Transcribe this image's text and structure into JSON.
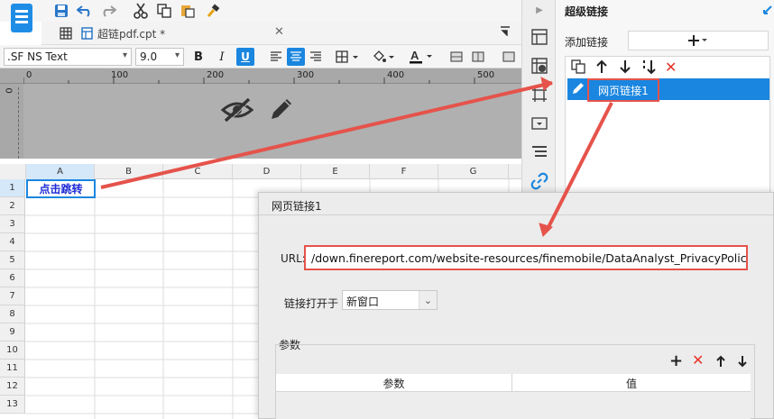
{
  "app": {
    "tab_title": "超链pdf.cpt *",
    "font_name": ".SF NS Text",
    "font_size": "9.0"
  },
  "format": {
    "bold": "B",
    "italic": "I",
    "underline": "U"
  },
  "ruler": {
    "ticks": [
      "0",
      "100",
      "200",
      "300",
      "400",
      "500"
    ],
    "vtick": "0"
  },
  "grid": {
    "columns": [
      "A",
      "B",
      "C",
      "D",
      "E",
      "F",
      "G"
    ],
    "rows": [
      "1",
      "2",
      "3",
      "4",
      "5",
      "6",
      "7",
      "8",
      "9",
      "10",
      "11",
      "12",
      "13"
    ],
    "cell_a1": "点击跳转"
  },
  "right_panel": {
    "title": "超级链接",
    "add_link_label": "添加链接",
    "links": [
      "网页链接1"
    ]
  },
  "dialog": {
    "title": "网页链接1",
    "url_label": "URL:",
    "url_value": "/down.finereport.com/website-resources/finemobile/DataAnalyst_PrivacyPolicy.pdf",
    "open_in_label": "链接打开于",
    "open_in_value": "新窗口",
    "params_section_label": "参数",
    "params_columns": [
      "参数",
      "值"
    ]
  },
  "colors": {
    "accent_blue": "#1a86e0",
    "annotation_red": "#e5534b"
  }
}
